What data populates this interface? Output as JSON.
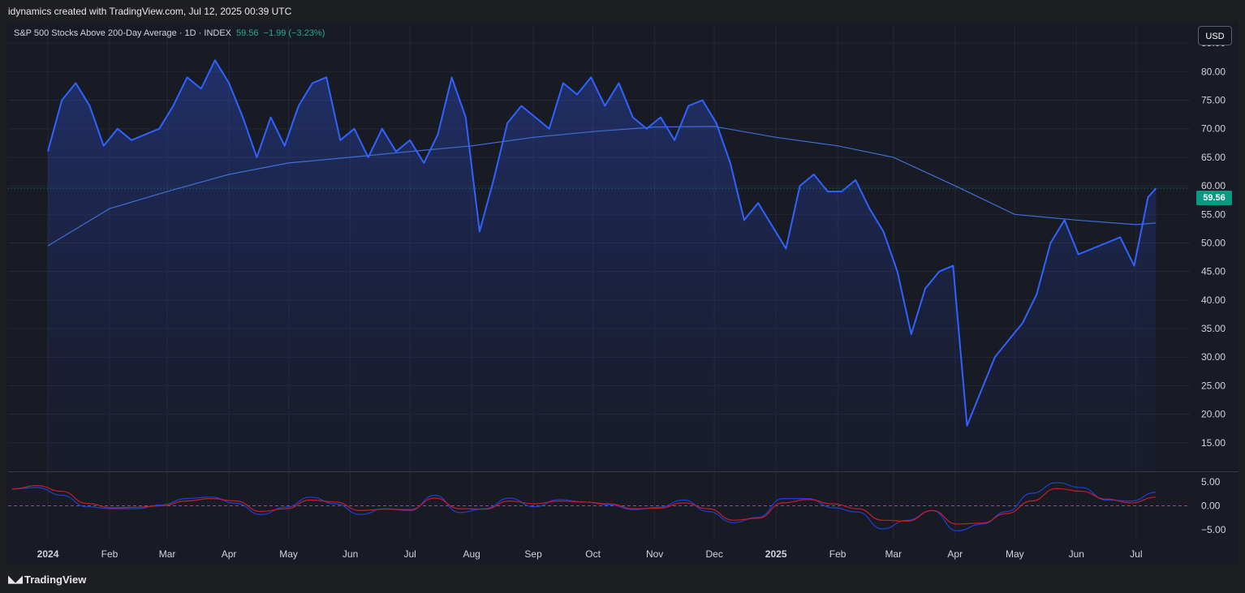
{
  "attribution": "idynamics created with TradingView.com, Jul 12, 2025 00:39 UTC",
  "legend": {
    "title": "S&P 500 Stocks Above 200-Day Average · 1D · INDEX",
    "value": "59.56",
    "change": "−1.99 (−3.23%)"
  },
  "currency": "USD",
  "price_badge": "59.56",
  "brand": "TradingView",
  "colors": {
    "line": "#2f62ff",
    "ma": "#3d6fd8",
    "osc_fast": "#1e3fd8",
    "osc_slow": "#c41e2a",
    "badge": "#089981",
    "grid": "#252836"
  },
  "chart_data": {
    "type": "line",
    "title": "S&P 500 Stocks Above 200-Day Average",
    "xlabel": "",
    "ylabel": "",
    "ylim": [
      10,
      88
    ],
    "y_ticks": [
      "85.00",
      "80.00",
      "75.00",
      "70.00",
      "65.00",
      "60.00",
      "55.00",
      "50.00",
      "45.00",
      "40.00",
      "35.00",
      "30.00",
      "25.00",
      "20.00",
      "15.00"
    ],
    "x_ticks": [
      "2024",
      "Feb",
      "Mar",
      "Apr",
      "May",
      "Jun",
      "Jul",
      "Aug",
      "Sep",
      "Oct",
      "Nov",
      "Dec",
      "2025",
      "Feb",
      "Mar",
      "Apr",
      "May",
      "Jun",
      "Jul"
    ],
    "last_value": 59.56,
    "series": [
      {
        "x": [
          "2024-01-01",
          "2024-01-08",
          "2024-01-15",
          "2024-01-22",
          "2024-01-29",
          "2024-02-05",
          "2024-02-12",
          "2024-02-19",
          "2024-02-26",
          "2024-03-04",
          "2024-03-11",
          "2024-03-18",
          "2024-03-25",
          "2024-04-01",
          "2024-04-08",
          "2024-04-15",
          "2024-04-22",
          "2024-04-29",
          "2024-05-06",
          "2024-05-13",
          "2024-05-20",
          "2024-05-27",
          "2024-06-03",
          "2024-06-10",
          "2024-06-17",
          "2024-06-24",
          "2024-07-01",
          "2024-07-08",
          "2024-07-15",
          "2024-07-22",
          "2024-07-29",
          "2024-08-05",
          "2024-08-12",
          "2024-08-19",
          "2024-08-26",
          "2024-09-02",
          "2024-09-09",
          "2024-09-16",
          "2024-09-23",
          "2024-09-30",
          "2024-10-07",
          "2024-10-14",
          "2024-10-21",
          "2024-10-28",
          "2024-11-04",
          "2024-11-11",
          "2024-11-18",
          "2024-11-25",
          "2024-12-02",
          "2024-12-09",
          "2024-12-16",
          "2024-12-23",
          "2024-12-30",
          "2025-01-06",
          "2025-01-13",
          "2025-01-20",
          "2025-01-27",
          "2025-02-03",
          "2025-02-10",
          "2025-02-17",
          "2025-02-24",
          "2025-03-03",
          "2025-03-10",
          "2025-03-17",
          "2025-03-24",
          "2025-03-31",
          "2025-04-07",
          "2025-04-14",
          "2025-04-21",
          "2025-04-28",
          "2025-05-05",
          "2025-05-12",
          "2025-05-19",
          "2025-05-26",
          "2025-06-02",
          "2025-06-09",
          "2025-06-16",
          "2025-06-23",
          "2025-06-30",
          "2025-07-07",
          "2025-07-11"
        ],
        "y": [
          66,
          75,
          78,
          74,
          67,
          70,
          68,
          69,
          70,
          74,
          79,
          77,
          82,
          78,
          72,
          65,
          72,
          67,
          74,
          78,
          79,
          68,
          70,
          65,
          70,
          66,
          68,
          64,
          69,
          79,
          72,
          52,
          61,
          71,
          74,
          72,
          70,
          78,
          76,
          79,
          74,
          78,
          72,
          70,
          72,
          68,
          74,
          75,
          71,
          64,
          54,
          57,
          53,
          49,
          60,
          62,
          59,
          59,
          61,
          56,
          52,
          45,
          34,
          42,
          45,
          46,
          18,
          24,
          30,
          33,
          36,
          41,
          50,
          54,
          48,
          49,
          50,
          51,
          46,
          58,
          59.56
        ],
        "name": "S&P 500 Stocks Above 200-Day Average"
      },
      {
        "x": [
          "2024-01-01",
          "2024-02-01",
          "2024-03-01",
          "2024-04-01",
          "2024-05-01",
          "2024-06-01",
          "2024-07-01",
          "2024-08-01",
          "2024-09-01",
          "2024-10-01",
          "2024-11-01",
          "2024-12-01",
          "2025-01-01",
          "2025-02-01",
          "2025-03-01",
          "2025-04-01",
          "2025-05-01",
          "2025-06-01",
          "2025-07-01",
          "2025-07-11"
        ],
        "y": [
          49.5,
          56,
          59,
          62,
          64,
          65,
          66,
          67,
          68.5,
          69.5,
          70.3,
          70.4,
          68.5,
          67,
          65,
          60,
          55,
          54,
          53.2,
          53.5
        ],
        "name": ""
      }
    ],
    "oscillator": {
      "ylim": [
        -7,
        7
      ],
      "y_ticks": [
        "5.00",
        "0.00",
        "−5.00"
      ],
      "fast": [
        3.5,
        3.8,
        2.2,
        -0.2,
        -0.6,
        -0.6,
        0.2,
        1.5,
        1.8,
        0.5,
        -1.8,
        -0.3,
        1.8,
        0.4,
        -1.8,
        -0.6,
        -1.0,
        2.2,
        -1.4,
        -0.6,
        1.6,
        -0.2,
        1.3,
        0.8,
        0.2,
        -0.8,
        -0.3,
        1.2,
        -1.2,
        -3.5,
        -2.4,
        1.5,
        1.5,
        -0.4,
        -1.3,
        -4.8,
        -3.0,
        -1.0,
        -5.2,
        -3.8,
        -1.2,
        2.6,
        4.8,
        3.8,
        1.2,
        1.0,
        2.8
      ],
      "slow": [
        3.5,
        4.2,
        3.0,
        0.5,
        -0.4,
        -0.3,
        0.0,
        1.0,
        1.5,
        1.0,
        -1.2,
        -0.6,
        1.2,
        0.8,
        -1.0,
        -0.7,
        -0.8,
        1.6,
        -0.6,
        -0.7,
        1.0,
        0.4,
        1.0,
        0.8,
        0.4,
        -0.6,
        -0.5,
        0.6,
        -0.6,
        -3.0,
        -2.6,
        0.6,
        1.3,
        0.4,
        -0.6,
        -3.0,
        -3.2,
        -1.0,
        -3.8,
        -3.6,
        -1.6,
        1.0,
        3.6,
        3.0,
        1.4,
        0.6,
        1.8
      ]
    }
  }
}
